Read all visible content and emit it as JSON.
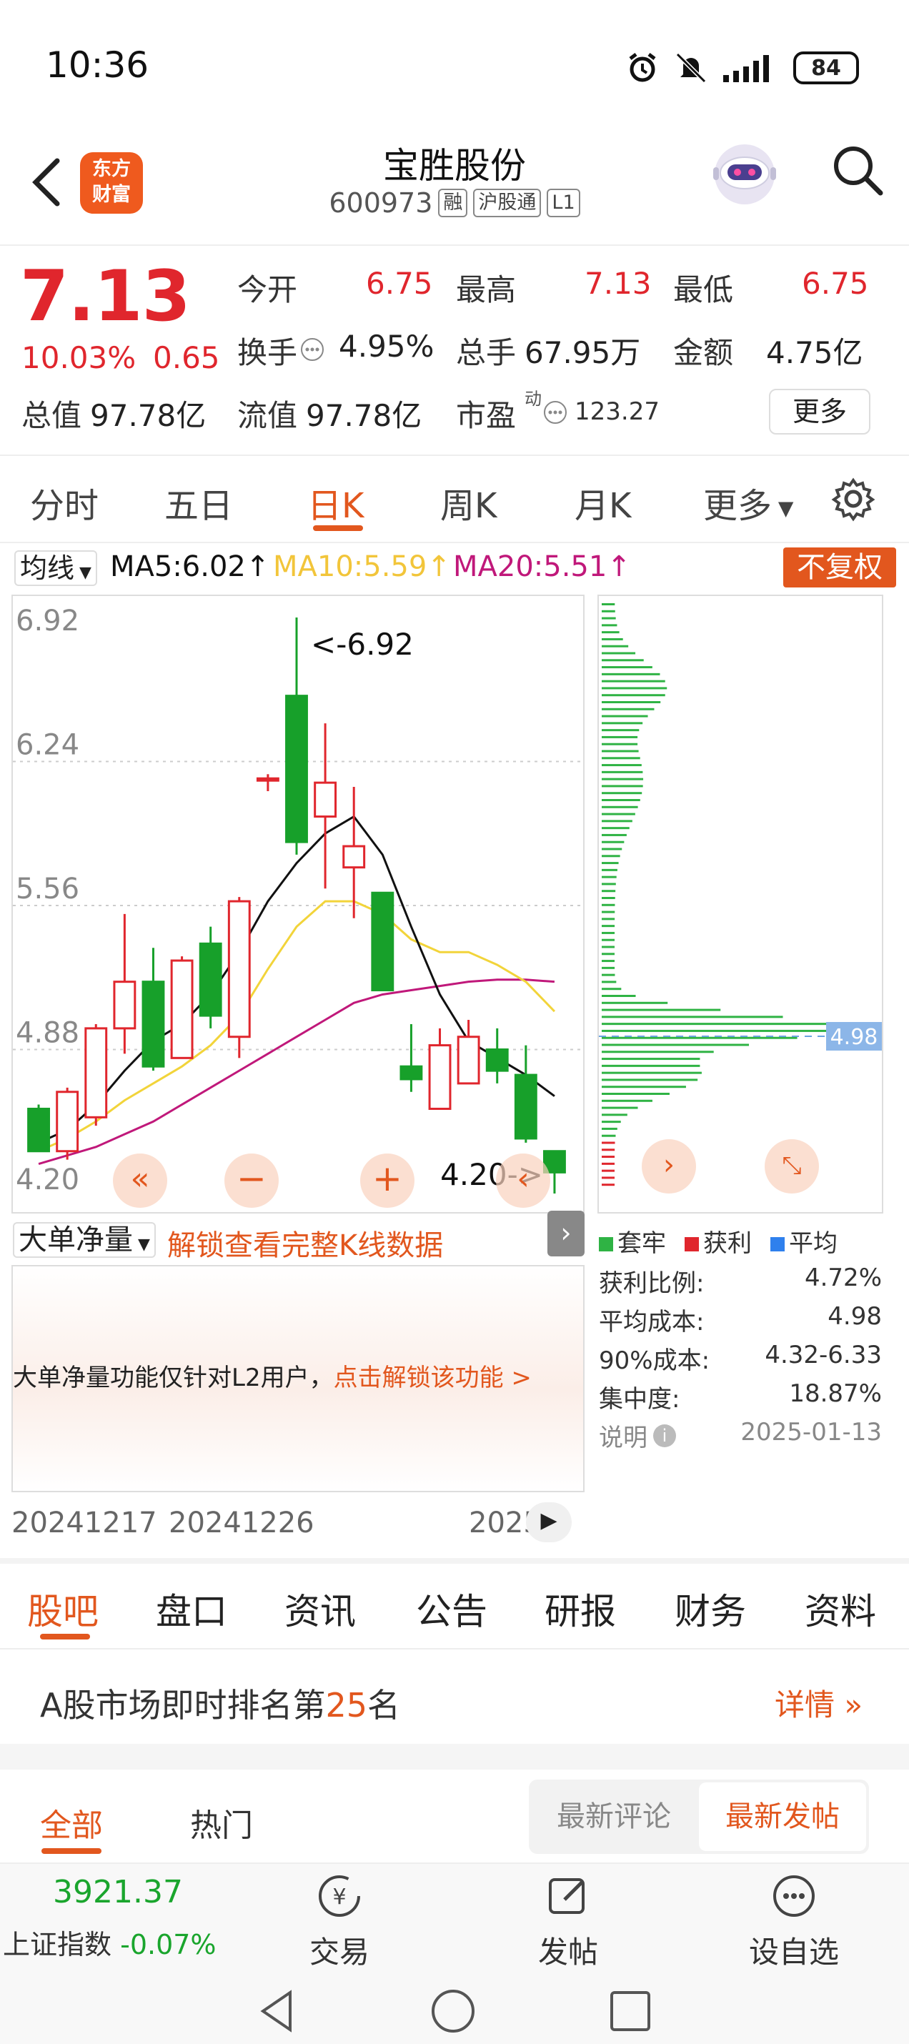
{
  "status_bar": {
    "time": "10:36",
    "battery": "84"
  },
  "header": {
    "logo_text_line1": "东方",
    "logo_text_line2": "财富",
    "stock_name": "宝胜股份",
    "stock_code": "600973",
    "tags": [
      "融",
      "沪股通",
      "L1"
    ]
  },
  "quote": {
    "price": "7.13",
    "change_pct": "10.03%",
    "change": "0.65",
    "open_label": "今开",
    "open": "6.75",
    "high_label": "最高",
    "high": "7.13",
    "low_label": "最低",
    "low": "6.75",
    "turnover_label": "换手",
    "turnover": "4.95%",
    "volume_label": "总手",
    "volume": "67.95万",
    "amount_label": "金额",
    "amount": "4.75亿",
    "mktcap_label": "总值",
    "mktcap": "97.78亿",
    "float_label": "流值",
    "float": "97.78亿",
    "pe_label": "市盈",
    "pe_sup": "动",
    "pe": "123.27",
    "more_button": "更多"
  },
  "period_tabs": [
    "分时",
    "五日",
    "日K",
    "周K",
    "月K",
    "更多"
  ],
  "period_active": "日K",
  "ma_legend": {
    "select": "均线",
    "ma5": "MA5:6.02↑",
    "ma10": "MA10:5.59↑",
    "ma20": "MA20:5.51↑",
    "adjust_button": "不复权",
    "colors": {
      "ma5": "#111111",
      "ma10": "#f2d43a",
      "ma20": "#c0187a"
    }
  },
  "chart_data": {
    "type": "candlestick",
    "price_axis_labels": [
      "6.92",
      "6.24",
      "5.56",
      "4.88",
      "4.20"
    ],
    "ylim": [
      4.2,
      6.92
    ],
    "max_marker": "<-6.92",
    "min_marker": "4.20->",
    "candles": [
      {
        "o": 4.6,
        "h": 4.62,
        "l": 4.4,
        "c": 4.4
      },
      {
        "o": 4.4,
        "h": 4.7,
        "l": 4.36,
        "c": 4.68
      },
      {
        "o": 4.56,
        "h": 5.0,
        "l": 4.52,
        "c": 4.98
      },
      {
        "o": 4.98,
        "h": 5.52,
        "l": 4.86,
        "c": 5.2
      },
      {
        "o": 5.2,
        "h": 5.36,
        "l": 4.78,
        "c": 4.8
      },
      {
        "o": 4.84,
        "h": 5.32,
        "l": 4.84,
        "c": 5.3
      },
      {
        "o": 5.38,
        "h": 5.46,
        "l": 4.98,
        "c": 5.04
      },
      {
        "o": 4.94,
        "h": 5.6,
        "l": 4.84,
        "c": 5.58
      },
      {
        "o": 6.16,
        "h": 6.18,
        "l": 6.1,
        "c": 6.16
      },
      {
        "o": 6.55,
        "h": 6.92,
        "l": 5.8,
        "c": 5.86
      },
      {
        "o": 5.98,
        "h": 6.42,
        "l": 5.64,
        "c": 6.14
      },
      {
        "o": 5.74,
        "h": 6.12,
        "l": 5.5,
        "c": 5.84
      },
      {
        "o": 5.62,
        "h": 5.62,
        "l": 5.16,
        "c": 5.16
      },
      {
        "o": 4.8,
        "h": 5.0,
        "l": 4.68,
        "c": 4.74
      },
      {
        "o": 4.6,
        "h": 4.98,
        "l": 4.6,
        "c": 4.9
      },
      {
        "o": 4.72,
        "h": 5.02,
        "l": 4.72,
        "c": 4.94
      },
      {
        "o": 4.88,
        "h": 4.98,
        "l": 4.72,
        "c": 4.78
      },
      {
        "o": 4.76,
        "h": 4.9,
        "l": 4.44,
        "c": 4.46
      },
      {
        "o": 4.4,
        "h": 4.4,
        "l": 4.2,
        "c": 4.3
      }
    ],
    "ma5": [
      4.44,
      4.5,
      4.62,
      4.78,
      4.92,
      5.0,
      5.14,
      5.34,
      5.58,
      5.76,
      5.9,
      5.98,
      5.8,
      5.46,
      5.14,
      4.92,
      4.84,
      4.76,
      4.66
    ],
    "ma10": [
      4.4,
      4.46,
      4.54,
      4.64,
      4.72,
      4.8,
      4.9,
      5.04,
      5.26,
      5.46,
      5.58,
      5.58,
      5.52,
      5.4,
      5.34,
      5.34,
      5.28,
      5.2,
      5.06
    ],
    "ma20": [
      4.34,
      4.38,
      4.42,
      4.48,
      4.54,
      4.62,
      4.7,
      4.78,
      4.86,
      4.94,
      5.02,
      5.1,
      5.14,
      5.16,
      5.18,
      5.2,
      5.21,
      5.21,
      5.2
    ],
    "dates": [
      "20241217",
      "20241226",
      "2025"
    ]
  },
  "chips": {
    "avg_cost_marker": "4.98",
    "legend": [
      "套牢",
      "获利",
      "平均"
    ],
    "legend_colors": [
      "#2fb344",
      "#e0262d",
      "#2f80ed"
    ],
    "stats": [
      {
        "label": "获利比例:",
        "value": "4.72%"
      },
      {
        "label": "平均成本:",
        "value": "4.98"
      },
      {
        "label": "90%成本:",
        "value": "4.32-6.33"
      },
      {
        "label": "集中度:",
        "value": "18.87%"
      }
    ],
    "note_label": "说明",
    "date": "2025-01-13"
  },
  "subchart": {
    "select": "大单净量",
    "unlock_text": "解锁查看完整K线数据",
    "notice": "大单净量功能仅针对L2用户，",
    "notice_link": "点击解锁该功能 >"
  },
  "info_tabs": [
    "股吧",
    "盘口",
    "资讯",
    "公告",
    "研报",
    "财务",
    "资料"
  ],
  "info_active": "股吧",
  "rank": {
    "prefix": "A股市场即时排名第",
    "rank": "25",
    "suffix": "名",
    "detail": "详情"
  },
  "feed": {
    "tab_all": "全部",
    "tab_hot": "热门",
    "sort_comment": "最新评论",
    "sort_post": "最新发帖"
  },
  "bottom_nav": {
    "index_value": "3921.37",
    "index_name": "上证指数",
    "index_change": "-0.07%",
    "trade": "交易",
    "post": "发帖",
    "watchlist": "设自选"
  }
}
